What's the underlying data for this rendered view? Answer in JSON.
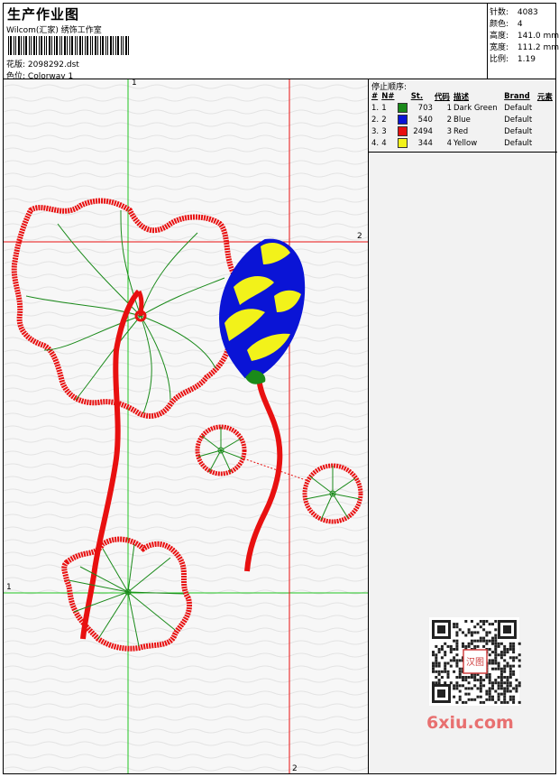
{
  "header": {
    "title": "生产作业图",
    "studio": "Wilcom(汇家) 绣饰工作室",
    "file_label": "花版:",
    "file_name": "2098292.dst",
    "color_label": "色位:",
    "colorway": "Colorway 1"
  },
  "stats": [
    {
      "label": "针数:",
      "value": "4083"
    },
    {
      "label": "颜色:",
      "value": "4"
    },
    {
      "label": "高度:",
      "value": "141.0 mm"
    },
    {
      "label": "宽度:",
      "value": "111.2 mm"
    },
    {
      "label": "比例:",
      "value": "1.19"
    }
  ],
  "stop_sequence": {
    "label": "停止顺序:",
    "headers": [
      "#",
      "N#",
      "St.",
      "代码",
      "描述",
      "Brand",
      "元素"
    ],
    "rows": [
      {
        "index": "1.",
        "n": "1",
        "color": "#1a8a1a",
        "stitches": "703",
        "code": "1",
        "description": "Dark Green",
        "brand": "Default"
      },
      {
        "index": "2.",
        "n": "2",
        "color": "#0a14d6",
        "stitches": "540",
        "code": "2",
        "description": "Blue",
        "brand": "Default"
      },
      {
        "index": "3.",
        "n": "3",
        "color": "#e81010",
        "stitches": "2494",
        "code": "3",
        "description": "Red",
        "brand": "Default"
      },
      {
        "index": "4.",
        "n": "4",
        "color": "#f2f21a",
        "stitches": "344",
        "code": "4",
        "description": "Yellow",
        "brand": "Default"
      }
    ]
  },
  "axes": {
    "green_top": "1",
    "green_left": "1",
    "red_right": "2",
    "red_bottom": "2"
  },
  "watermark": "6xiu.com",
  "stamp": "汉图"
}
